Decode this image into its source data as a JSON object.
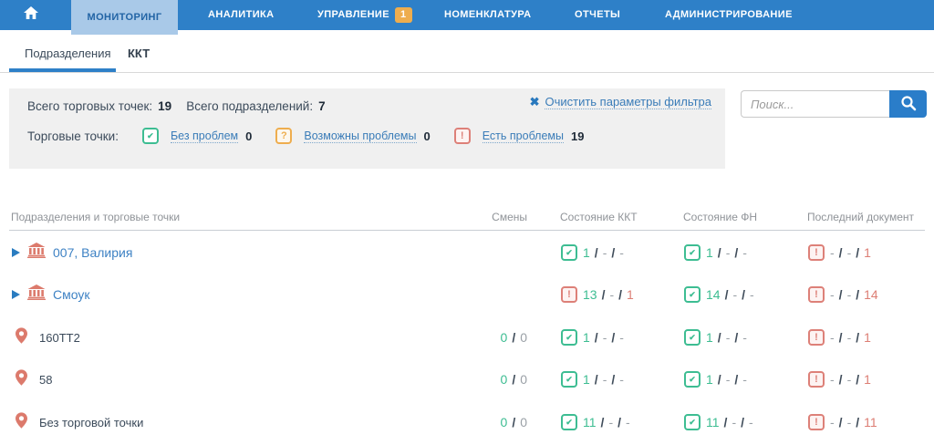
{
  "colors": {
    "accent_blue": "#2e80c8",
    "green": "#3dbd92",
    "orange": "#eead4e",
    "coral": "#dd7e74"
  },
  "navbar": {
    "items": [
      {
        "label": "МОНИТОРИНГ",
        "active": true
      },
      {
        "label": "АНАЛИТИКА"
      },
      {
        "label": "УПРАВЛЕНИЕ",
        "badge": "1"
      },
      {
        "label": "НОМЕНКЛАТУРА"
      },
      {
        "label": "ОТЧЕТЫ"
      },
      {
        "label": "АДМИНИСТРИРОВАНИЕ"
      }
    ]
  },
  "tabs": [
    {
      "label": "Подразделения",
      "active": true
    },
    {
      "label": "ККТ",
      "active": false
    }
  ],
  "filter": {
    "totals": {
      "label1": "Всего торговых точек:",
      "value1": "19",
      "label2": "Всего подразделений:",
      "value2": "7"
    },
    "points_label": "Торговые точки:",
    "statuses": [
      {
        "icon": "check",
        "label": "Без проблем",
        "value": "0"
      },
      {
        "icon": "question",
        "label": "Возможны проблемы",
        "value": "0"
      },
      {
        "icon": "excl",
        "label": "Есть проблемы",
        "value": "19"
      }
    ],
    "clear_label": "Очистить параметры фильтра"
  },
  "search": {
    "placeholder": "Поиск..."
  },
  "table": {
    "headers": {
      "name": "Подразделения и торговые точки",
      "shifts": "Смены",
      "kkt": "Состояние ККТ",
      "fn": "Состояние ФН",
      "doc": "Последний документ"
    },
    "rows": [
      {
        "type": "division",
        "name": "007, Валирия",
        "kkt": {
          "icon": "check",
          "tokens": [
            {
              "t": "1",
              "c": "green"
            },
            {
              "t": "/",
              "c": "slash"
            },
            {
              "t": "-",
              "c": "dash"
            },
            {
              "t": "/",
              "c": "slash"
            },
            {
              "t": "-",
              "c": "dash"
            }
          ]
        },
        "fn": {
          "icon": "check",
          "tokens": [
            {
              "t": "1",
              "c": "green"
            },
            {
              "t": "/",
              "c": "slash"
            },
            {
              "t": "-",
              "c": "dash"
            },
            {
              "t": "/",
              "c": "slash"
            },
            {
              "t": "-",
              "c": "dash"
            }
          ]
        },
        "doc": {
          "icon": "excl",
          "tokens": [
            {
              "t": "-",
              "c": "dash"
            },
            {
              "t": "/",
              "c": "slash"
            },
            {
              "t": "-",
              "c": "dash"
            },
            {
              "t": "/",
              "c": "slash"
            },
            {
              "t": "1",
              "c": "red"
            }
          ]
        }
      },
      {
        "type": "division",
        "name": "Смоук",
        "kkt": {
          "icon": "excl",
          "tokens": [
            {
              "t": "13",
              "c": "green"
            },
            {
              "t": "/",
              "c": "slash"
            },
            {
              "t": "-",
              "c": "dash"
            },
            {
              "t": "/",
              "c": "slash"
            },
            {
              "t": "1",
              "c": "red"
            }
          ]
        },
        "fn": {
          "icon": "check",
          "tokens": [
            {
              "t": "14",
              "c": "green"
            },
            {
              "t": "/",
              "c": "slash"
            },
            {
              "t": "-",
              "c": "dash"
            },
            {
              "t": "/",
              "c": "slash"
            },
            {
              "t": "-",
              "c": "dash"
            }
          ]
        },
        "doc": {
          "icon": "excl",
          "tokens": [
            {
              "t": "-",
              "c": "dash"
            },
            {
              "t": "/",
              "c": "slash"
            },
            {
              "t": "-",
              "c": "dash"
            },
            {
              "t": "/",
              "c": "slash"
            },
            {
              "t": "14",
              "c": "red"
            }
          ]
        }
      },
      {
        "type": "point",
        "name": "160ТТ2",
        "shifts": {
          "tokens": [
            {
              "t": "0",
              "c": "green"
            },
            {
              "t": "/",
              "c": "slash"
            },
            {
              "t": "0",
              "c": "gray"
            }
          ]
        },
        "kkt": {
          "icon": "check",
          "tokens": [
            {
              "t": "1",
              "c": "green"
            },
            {
              "t": "/",
              "c": "slash"
            },
            {
              "t": "-",
              "c": "dash"
            },
            {
              "t": "/",
              "c": "slash"
            },
            {
              "t": "-",
              "c": "dash"
            }
          ]
        },
        "fn": {
          "icon": "check",
          "tokens": [
            {
              "t": "1",
              "c": "green"
            },
            {
              "t": "/",
              "c": "slash"
            },
            {
              "t": "-",
              "c": "dash"
            },
            {
              "t": "/",
              "c": "slash"
            },
            {
              "t": "-",
              "c": "dash"
            }
          ]
        },
        "doc": {
          "icon": "excl",
          "tokens": [
            {
              "t": "-",
              "c": "dash"
            },
            {
              "t": "/",
              "c": "slash"
            },
            {
              "t": "-",
              "c": "dash"
            },
            {
              "t": "/",
              "c": "slash"
            },
            {
              "t": "1",
              "c": "red"
            }
          ]
        }
      },
      {
        "type": "point",
        "name": "58",
        "shifts": {
          "tokens": [
            {
              "t": "0",
              "c": "green"
            },
            {
              "t": "/",
              "c": "slash"
            },
            {
              "t": "0",
              "c": "gray"
            }
          ]
        },
        "kkt": {
          "icon": "check",
          "tokens": [
            {
              "t": "1",
              "c": "green"
            },
            {
              "t": "/",
              "c": "slash"
            },
            {
              "t": "-",
              "c": "dash"
            },
            {
              "t": "/",
              "c": "slash"
            },
            {
              "t": "-",
              "c": "dash"
            }
          ]
        },
        "fn": {
          "icon": "check",
          "tokens": [
            {
              "t": "1",
              "c": "green"
            },
            {
              "t": "/",
              "c": "slash"
            },
            {
              "t": "-",
              "c": "dash"
            },
            {
              "t": "/",
              "c": "slash"
            },
            {
              "t": "-",
              "c": "dash"
            }
          ]
        },
        "doc": {
          "icon": "excl",
          "tokens": [
            {
              "t": "-",
              "c": "dash"
            },
            {
              "t": "/",
              "c": "slash"
            },
            {
              "t": "-",
              "c": "dash"
            },
            {
              "t": "/",
              "c": "slash"
            },
            {
              "t": "1",
              "c": "red"
            }
          ]
        }
      },
      {
        "type": "point",
        "name": "Без торговой точки",
        "shifts": {
          "tokens": [
            {
              "t": "0",
              "c": "green"
            },
            {
              "t": "/",
              "c": "slash"
            },
            {
              "t": "0",
              "c": "gray"
            }
          ]
        },
        "kkt": {
          "icon": "check",
          "tokens": [
            {
              "t": "11",
              "c": "green"
            },
            {
              "t": "/",
              "c": "slash"
            },
            {
              "t": "-",
              "c": "dash"
            },
            {
              "t": "/",
              "c": "slash"
            },
            {
              "t": "-",
              "c": "dash"
            }
          ]
        },
        "fn": {
          "icon": "check",
          "tokens": [
            {
              "t": "11",
              "c": "green"
            },
            {
              "t": "/",
              "c": "slash"
            },
            {
              "t": "-",
              "c": "dash"
            },
            {
              "t": "/",
              "c": "slash"
            },
            {
              "t": "-",
              "c": "dash"
            }
          ]
        },
        "doc": {
          "icon": "excl",
          "tokens": [
            {
              "t": "-",
              "c": "dash"
            },
            {
              "t": "/",
              "c": "slash"
            },
            {
              "t": "-",
              "c": "dash"
            },
            {
              "t": "/",
              "c": "slash"
            },
            {
              "t": "11",
              "c": "red"
            }
          ]
        }
      }
    ]
  }
}
